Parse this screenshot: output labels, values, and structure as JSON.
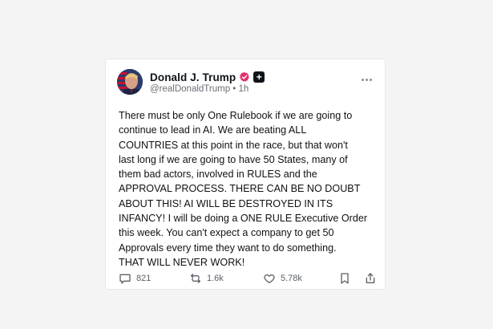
{
  "post": {
    "author_name": "Donald J. Trump",
    "handle": "@realDonaldTrump",
    "separator": "•",
    "time": "1h",
    "plus_symbol": "+",
    "text": "There must be only One Rulebook if we are going to\ncontinue to lead in AI. We are beating ALL\nCOUNTRIES at this point in the race, but that won't\nlast long if we are going to have 50 States, many of\nthem bad actors, involved in RULES and the\nAPPROVAL PROCESS. THERE CAN BE NO DOUBT\nABOUT THIS! AI WILL BE DESTROYED IN ITS\nINFANCY! I will be doing a ONE RULE Executive Order\nthis week. You can't expect a company to get 50\nApprovals every time they want to do something.\nTHAT WILL NEVER WORK!",
    "icons": {
      "avatar": "avatar-image",
      "verified": "verified-badge-icon",
      "plus": "plus-badge-icon",
      "more": "more-options-icon",
      "reply": "reply-icon",
      "repost": "repost-icon",
      "like": "heart-icon",
      "bookmark": "bookmark-icon",
      "share": "share-icon"
    },
    "metrics": {
      "replies": "821",
      "reposts": "1.6k",
      "likes": "5.78k"
    },
    "colors": {
      "verified": "#e1306c",
      "background": "#f4f4f5",
      "card": "#ffffff",
      "muted_text": "#6b6f76"
    }
  }
}
